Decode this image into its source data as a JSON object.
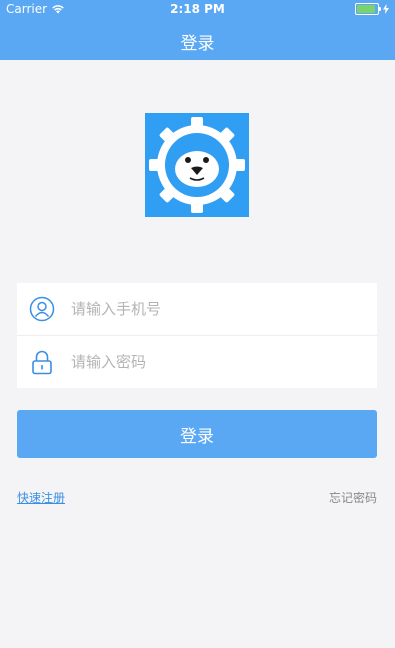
{
  "status_bar": {
    "carrier": "Carrier",
    "time": "2:18 PM"
  },
  "nav": {
    "title": "登录"
  },
  "logo": {
    "icon": "lion-gear-logo",
    "background_color": "#2f9ef3"
  },
  "form": {
    "phone_placeholder": "请输入手机号",
    "password_placeholder": "请输入密码"
  },
  "login_button": {
    "label": "登录",
    "color": "#5aa8f4"
  },
  "links": {
    "register": "快速注册",
    "forgot_password": "忘记密码"
  }
}
